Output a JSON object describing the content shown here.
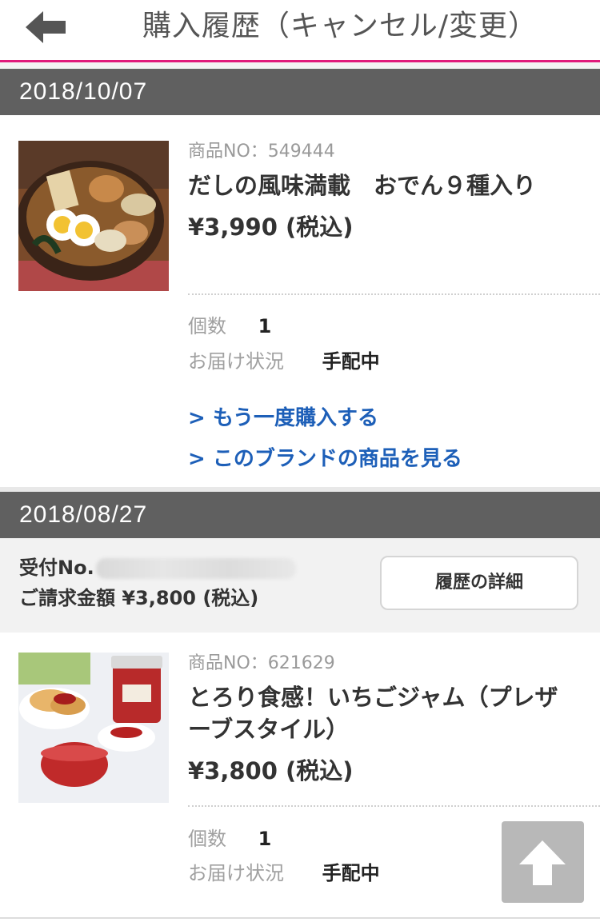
{
  "header": {
    "title": "購入履歴（キャンセル/変更）",
    "back_icon": "left-arrow-icon"
  },
  "colors": {
    "accent": "#e0197a",
    "date_bar": "#606060",
    "link": "#1d5fb8"
  },
  "orders": [
    {
      "date": "2018/10/07",
      "items": [
        {
          "product_no": "商品NO：549444",
          "name": "だしの風味満載　おでん９種入り",
          "price": "¥3,990 (税込)",
          "qty_label": "個数",
          "qty": "1",
          "status_label": "お届け状況",
          "status": "手配中",
          "link_rebuy": "> もう一度購入する",
          "link_brand": "> このブランドの商品を見る"
        }
      ]
    },
    {
      "date": "2018/08/27",
      "receipt_label": "受付No.",
      "billing": "ご請求金額 ¥3,800 (税込)",
      "detail_button": "履歴の詳細",
      "items": [
        {
          "product_no": "商品NO：621629",
          "name": "とろり食感！いちごジャム（プレザーブスタイル）",
          "price": "¥3,800 (税込)",
          "qty_label": "個数",
          "qty": "1",
          "status_label": "お届け状況",
          "status": "手配中"
        }
      ]
    }
  ],
  "scroll_top_icon": "up-arrow-icon"
}
